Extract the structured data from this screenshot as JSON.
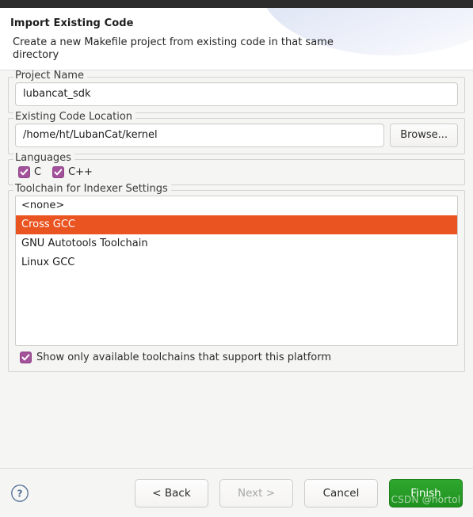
{
  "window": {
    "titlebar_color": "#2c2c2c"
  },
  "header": {
    "title": "Import Existing Code",
    "description": "Create a new Makefile project from existing code in that same directory"
  },
  "project_name_group": {
    "label": "Project Name",
    "value": "lubancat_sdk",
    "placeholder": ""
  },
  "existing_code_group": {
    "label": "Existing Code Location",
    "value": "/home/ht/LubanCat/kernel",
    "placeholder": "",
    "browse_label": "Browse..."
  },
  "languages_group": {
    "label": "Languages",
    "items": [
      {
        "label": "C",
        "checked": true
      },
      {
        "label": "C++",
        "checked": true
      }
    ]
  },
  "toolchain_group": {
    "label": "Toolchain for Indexer Settings",
    "items": [
      {
        "label": "<none>",
        "selected": false
      },
      {
        "label": "Cross GCC",
        "selected": true
      },
      {
        "label": "GNU Autotools Toolchain",
        "selected": false
      },
      {
        "label": "Linux GCC",
        "selected": false
      }
    ],
    "filter_checkbox": {
      "label": "Show only available toolchains that support this platform",
      "checked": true
    }
  },
  "button_bar": {
    "help_icon": "help-circle-icon",
    "back_label": "< Back",
    "next_label": "Next >",
    "next_enabled": false,
    "cancel_label": "Cancel",
    "finish_label": "Finish",
    "watermark": "CSDN @hortol"
  },
  "colors": {
    "selection_orange": "#e95420",
    "checkbox_purple": "#a3519a",
    "finish_green": "#2fa82f",
    "dialog_background": "#f5f5f4"
  }
}
